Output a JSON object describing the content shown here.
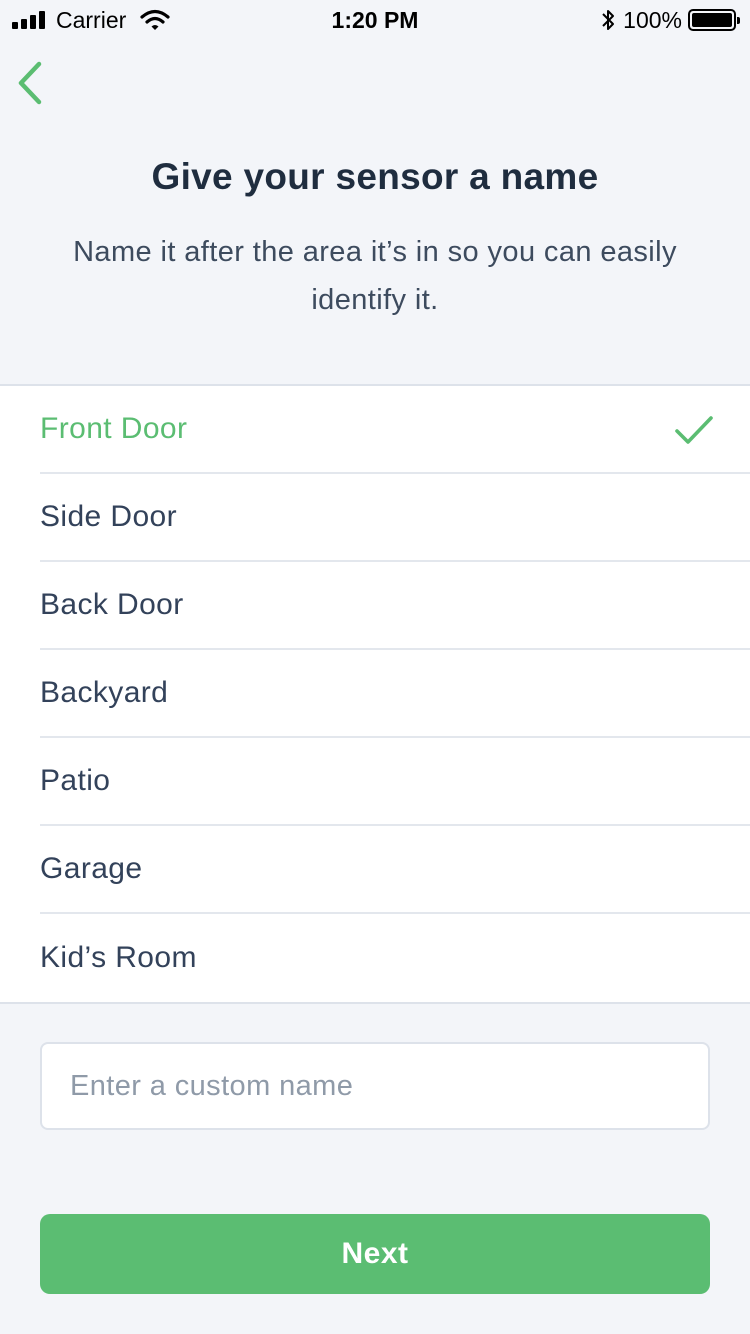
{
  "status_bar": {
    "carrier": "Carrier",
    "time": "1:20 PM",
    "battery": "100%",
    "icons": [
      "signal-icon",
      "wifi-icon",
      "bluetooth-icon",
      "battery-icon"
    ]
  },
  "header": {
    "title": "Give your sensor a name",
    "subtitle": "Name it after the area it’s in so you can easily identify it."
  },
  "names": {
    "items": [
      {
        "label": "Front Door",
        "selected": true
      },
      {
        "label": "Side Door",
        "selected": false
      },
      {
        "label": "Back Door",
        "selected": false
      },
      {
        "label": "Backyard",
        "selected": false
      },
      {
        "label": "Patio",
        "selected": false
      },
      {
        "label": "Garage",
        "selected": false
      },
      {
        "label": "Kid’s Room",
        "selected": false
      }
    ]
  },
  "custom": {
    "placeholder": "Enter a custom name",
    "value": ""
  },
  "actions": {
    "next_label": "Next"
  },
  "colors": {
    "accent": "#5bbd72",
    "title": "#1f2d3f",
    "text": "#33425a",
    "background": "#f3f5f9"
  }
}
